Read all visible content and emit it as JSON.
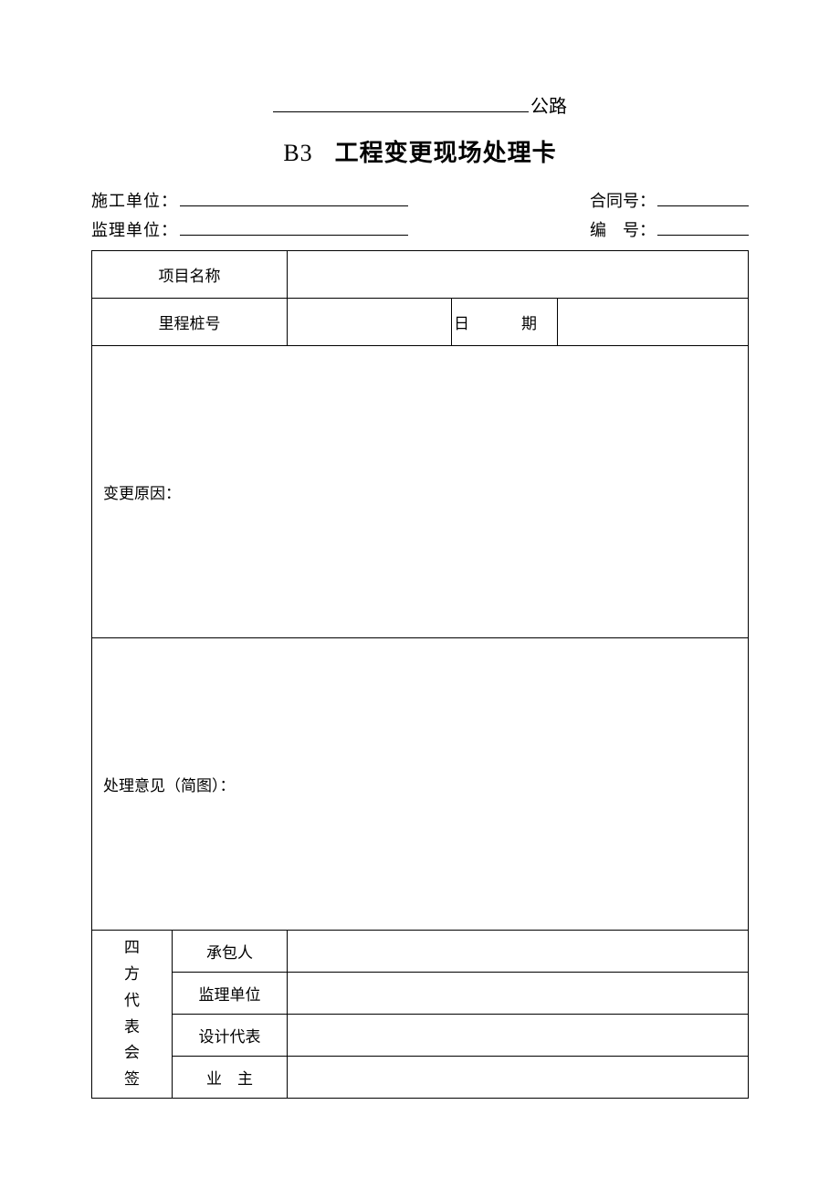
{
  "header": {
    "suffix": "公路"
  },
  "title": {
    "code": "B3",
    "main": "工程变更现场处理卡"
  },
  "meta": {
    "construction_unit_label": "施工单位：",
    "supervision_unit_label": "监理单位：",
    "contract_no_label": "合同号：",
    "serial_no_label": "编　号："
  },
  "table": {
    "project_name_label": "项目名称",
    "mileage_label": "里程桩号",
    "date_label": "日　期",
    "change_reason_label": "变更原因：",
    "handling_opinion_label": "处理意见（简图）：",
    "four_party_label": [
      "四",
      "方",
      "代",
      "表",
      "会",
      "签"
    ],
    "sig": {
      "contractor": "承包人",
      "supervisor": "监理单位",
      "designer": "设计代表",
      "owner": "业　主"
    }
  }
}
